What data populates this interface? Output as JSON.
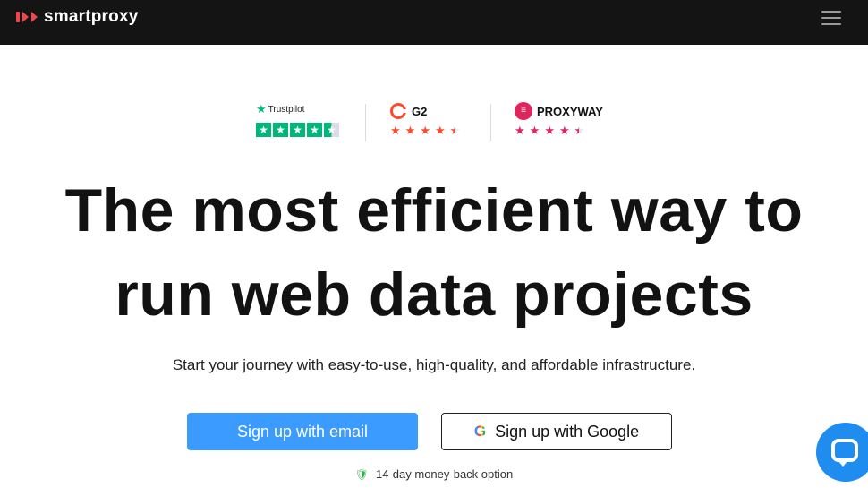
{
  "header": {
    "logo_text": "smartproxy",
    "menu_icon": "hamburger-icon"
  },
  "ratings": {
    "trustpilot": {
      "label": "Trustpilot",
      "stars": 4.5
    },
    "g2": {
      "label": "G2",
      "stars": 4.5
    },
    "proxyway": {
      "label": "PROXYWAY",
      "stars": 4.5
    }
  },
  "hero": {
    "headline_line1": "The most efficient way to",
    "headline_line2": "run web data projects",
    "subtitle": "Start your journey with easy-to-use, high-quality, and affordable infrastructure."
  },
  "cta": {
    "email_label": "Sign up with email",
    "google_label": "Sign up with Google",
    "guarantee": "14-day money-back option"
  },
  "colors": {
    "topbar": "#141414",
    "brand": "#f0454f",
    "primary_button": "#3b9bff",
    "trustpilot_green": "#00b67a",
    "g2_orange": "#ff492c",
    "proxyway_pink": "#e0245e",
    "chat": "#1f8cf0"
  }
}
